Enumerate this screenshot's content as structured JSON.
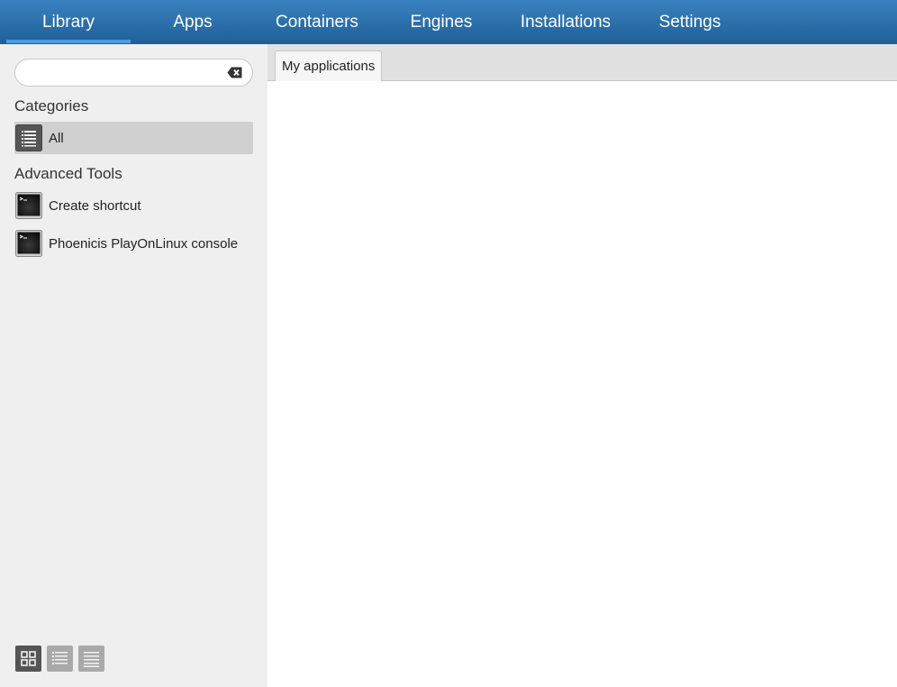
{
  "nav": {
    "tabs": [
      {
        "label": "Library",
        "active": true
      },
      {
        "label": "Apps",
        "active": false
      },
      {
        "label": "Containers",
        "active": false
      },
      {
        "label": "Engines",
        "active": false
      },
      {
        "label": "Installations",
        "active": false
      },
      {
        "label": "Settings",
        "active": false
      }
    ]
  },
  "sidebar": {
    "search": {
      "value": "",
      "placeholder": ""
    },
    "categories_title": "Categories",
    "categories": [
      {
        "label": "All",
        "icon": "list-icon",
        "selected": true
      }
    ],
    "tools_title": "Advanced Tools",
    "tools": [
      {
        "label": "Create shortcut",
        "icon": "terminal-icon"
      },
      {
        "label": "Phoenicis PlayOnLinux console",
        "icon": "terminal-icon"
      }
    ],
    "view_modes": [
      {
        "name": "icons-view",
        "active": true
      },
      {
        "name": "compact-list-view",
        "active": false
      },
      {
        "name": "detailed-list-view",
        "active": false
      }
    ]
  },
  "main": {
    "tabs": [
      {
        "label": "My applications",
        "active": true
      }
    ]
  },
  "colors": {
    "nav_top": "#3a82c0",
    "nav_bottom": "#1f5f97",
    "nav_active_underline": "#4a9be0",
    "sidebar_bg": "#efefef",
    "selected_bg": "#d0d0d0",
    "tabstrip_bg": "#e1e1e1"
  }
}
